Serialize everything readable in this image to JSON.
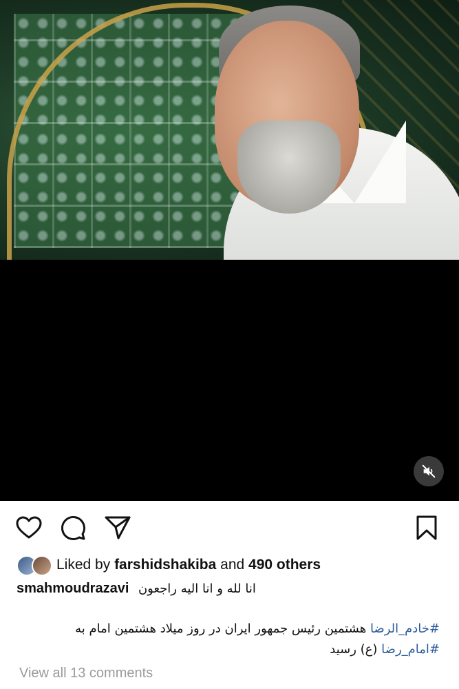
{
  "post": {
    "media": {
      "type": "video",
      "mute_icon": "speaker-muted-icon"
    },
    "actions": {
      "like_icon": "heart-icon",
      "comment_icon": "speech-bubble-icon",
      "share_icon": "paper-plane-icon",
      "save_icon": "bookmark-icon"
    },
    "likes": {
      "prefix": "Liked by",
      "username": "farshidshakiba",
      "connector": "and",
      "others": "490 others"
    },
    "caption": {
      "author": "smahmoudrazavi",
      "first_line": "انا لله و انا الیه راجعون",
      "hashtag_1": "#خادم_الرضا",
      "body_1": " هشتمین رئیس جمهور ایران در روز میلاد هشتمین امام به ",
      "hashtag_2": "#امام_رضا",
      "body_2": " (ع) رسید"
    },
    "comments_link": "View all 13 comments"
  },
  "colors": {
    "hashtag": "#2b5c9a",
    "muted_text": "#9a9a9a",
    "video_background": "#000000"
  }
}
